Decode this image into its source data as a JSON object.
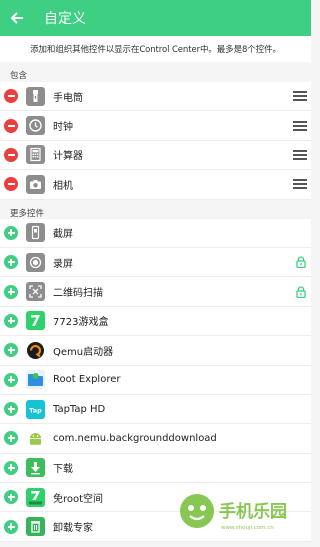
{
  "appbar": {
    "title": "自定义"
  },
  "description": "添加和组织其他控件以显示在Control Center中。最多是8个控件。",
  "included": {
    "label": "包含",
    "items": [
      {
        "label": "手电筒",
        "icon": "flashlight-icon"
      },
      {
        "label": "时钟",
        "icon": "clock-icon"
      },
      {
        "label": "计算器",
        "icon": "calculator-icon"
      },
      {
        "label": "相机",
        "icon": "camera-icon"
      }
    ]
  },
  "more": {
    "label": "更多控件",
    "items": [
      {
        "label": "截屏",
        "icon": "screenshot-icon",
        "locked": false
      },
      {
        "label": "录屏",
        "icon": "screen-record-icon",
        "locked": true
      },
      {
        "label": "二维码扫描",
        "icon": "qr-scan-icon",
        "locked": true
      },
      {
        "label": "7723游戏盒",
        "icon": "7723-app-icon"
      },
      {
        "label": "Qemu启动器",
        "icon": "qemu-app-icon"
      },
      {
        "label": "Root Explorer",
        "icon": "root-explorer-app-icon"
      },
      {
        "label": "TapTap HD",
        "icon": "taptap-app-icon"
      },
      {
        "label": "com.nemu.backgrounddownload",
        "icon": "android-app-icon"
      },
      {
        "label": "下载",
        "icon": "download-app-icon"
      },
      {
        "label": "免root空间",
        "icon": "7723-space-app-icon"
      },
      {
        "label": "卸载专家",
        "icon": "uninstall-app-icon"
      }
    ]
  },
  "watermark": {
    "text": "手机乐园",
    "url": "www.shouji.com.cn"
  },
  "colors": {
    "accent": "#3ecf82",
    "remove": "#e8403f",
    "lock": "#3ecf82"
  }
}
